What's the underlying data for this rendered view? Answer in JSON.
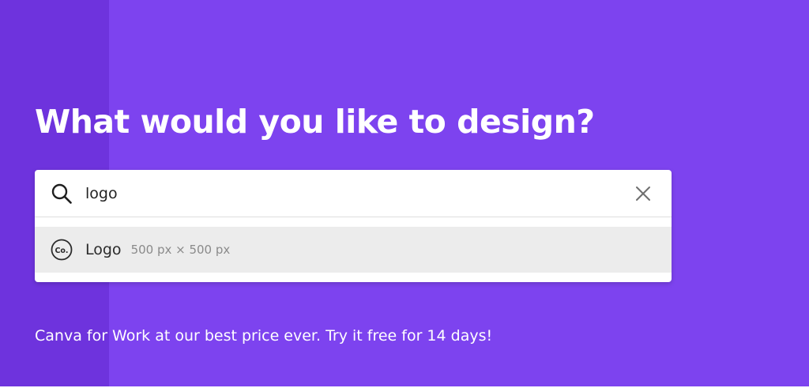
{
  "colors": {
    "hero_background": "#7d43ef",
    "hero_left_band": "#6e33dd",
    "suggestion_highlight": "#ececec",
    "text_white": "#ffffff"
  },
  "hero": {
    "headline": "What would you like to design?",
    "promo_text": "Canva for Work at our best price ever. Try it free for 14 days!"
  },
  "search": {
    "icon": "search-icon",
    "value": "logo",
    "clear_icon": "close-icon"
  },
  "suggestions": [
    {
      "icon": "canva-logo-icon",
      "icon_text": "Co.",
      "label": "Logo",
      "dimensions": "500 px × 500 px"
    }
  ]
}
